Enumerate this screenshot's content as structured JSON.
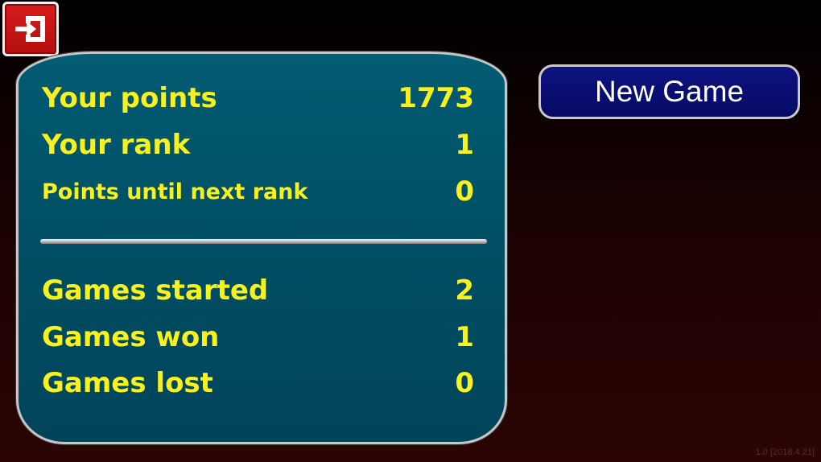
{
  "toolbar": {
    "exit_icon": "exit-arrow-icon"
  },
  "stats": {
    "your_points": {
      "label": "Your points",
      "value": "1773"
    },
    "your_rank": {
      "label": "Your rank",
      "value": "1"
    },
    "points_until_next_rank": {
      "label": "Points until next rank",
      "value": "0"
    },
    "games_started": {
      "label": "Games started",
      "value": "2"
    },
    "games_won": {
      "label": "Games won",
      "value": "1"
    },
    "games_lost": {
      "label": "Games lost",
      "value": "0"
    }
  },
  "new_game_label": "New Game",
  "version": "1.0 [2018.4.21]",
  "colors": {
    "stat_text": "#f8f11d",
    "panel": "#005166",
    "new_game_button": "#0a0e75",
    "exit_button": "#c81414"
  }
}
